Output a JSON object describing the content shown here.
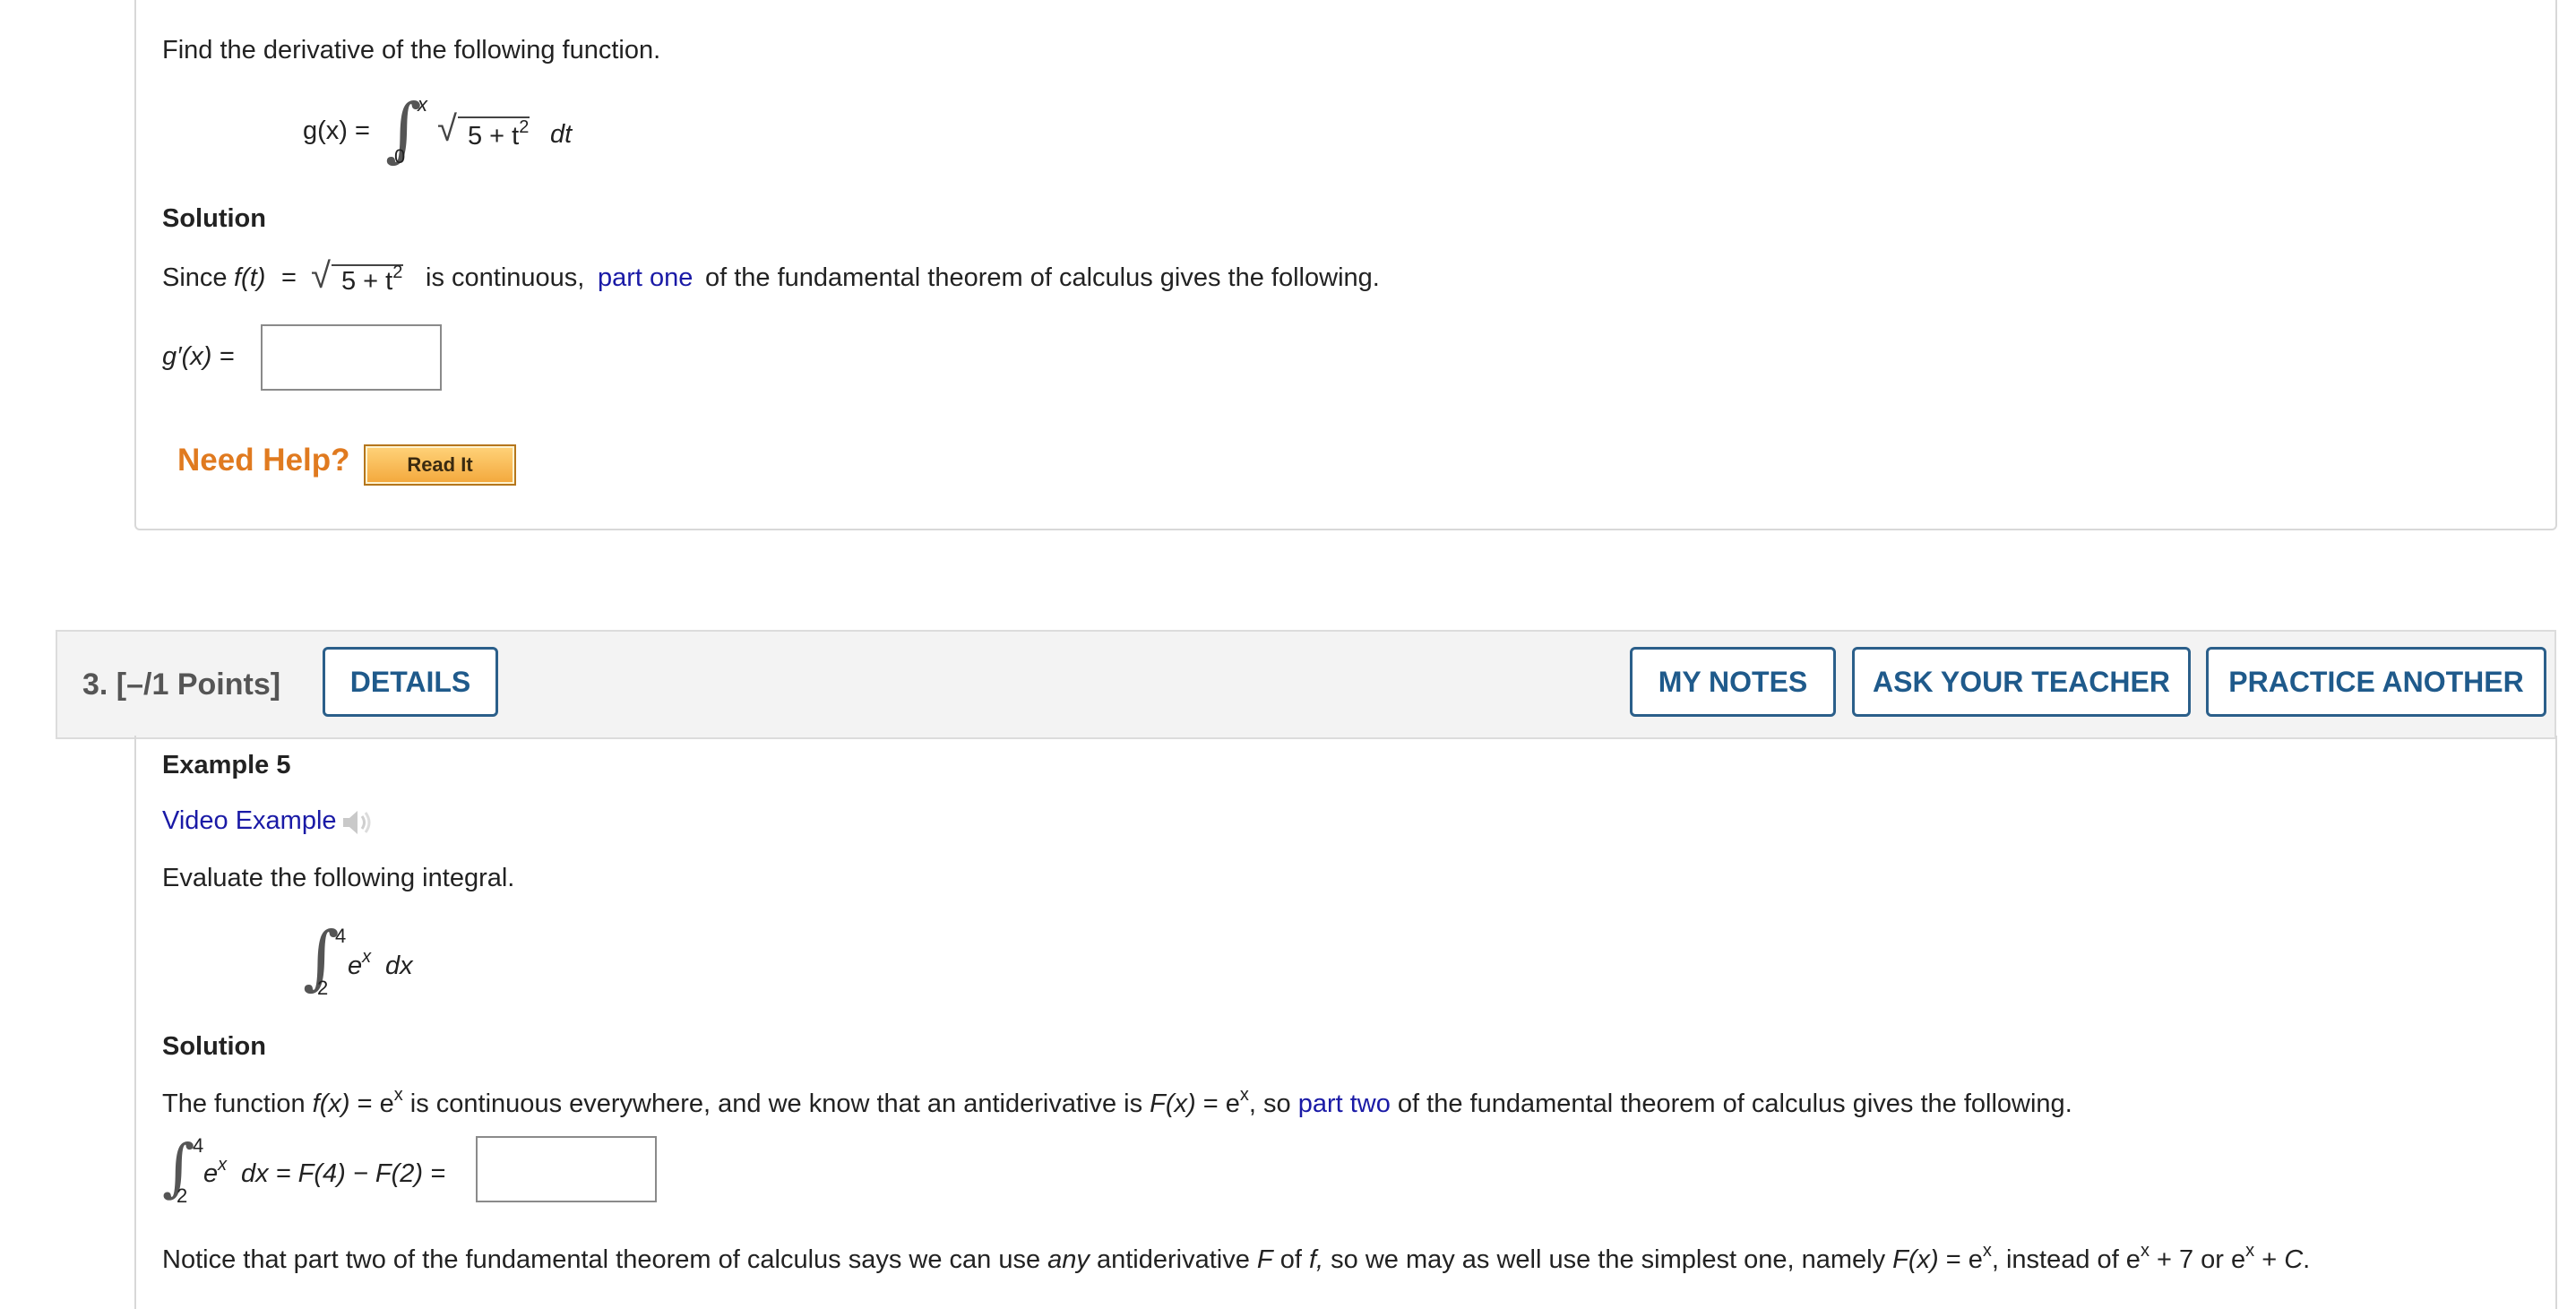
{
  "q2": {
    "instruction": "Find the derivative of the following function.",
    "function_lhs": "g(x) =",
    "upper_limit": "x",
    "lower_limit": "0",
    "radicand_a": "5 + t",
    "radicand_exp": "2",
    "dt": "dt",
    "solution_heading": "Solution",
    "since_a": "Since",
    "since_f": "f(t)",
    "since_eq": "=",
    "since_rad_a": "5 + t",
    "since_rad_exp": "2",
    "since_b": "is continuous,",
    "link_part_one": "part one",
    "since_c": "of the fundamental theorem of calculus gives the following.",
    "answer_label": "g′(x) =",
    "need_help": "Need Help?",
    "read_it": "Read It"
  },
  "q3": {
    "header_title": "3.  [–/1 Points]",
    "buttons": {
      "details": "DETAILS",
      "my_notes": "MY NOTES",
      "ask_teacher": "ASK YOUR TEACHER",
      "practice_another": "PRACTICE ANOTHER"
    },
    "example_heading": "Example 5",
    "video_example": "Video Example",
    "instruction": "Evaluate the following integral.",
    "upper_limit": "4",
    "lower_limit": "2",
    "integrand_base": "e",
    "integrand_exp": "x",
    "dx": "dx",
    "solution_heading": "Solution",
    "sentence_a": "The function",
    "sentence_f": "f(x)",
    "sentence_b": "= e",
    "sentence_b_exp": "x",
    "sentence_c": "is continuous everywhere, and we know that an antiderivative is",
    "sentence_F": "F(x)",
    "sentence_d": "= e",
    "sentence_d_exp": "x",
    "sentence_e": ", so",
    "link_part_two": "part two",
    "sentence_f2": "of the fundamental theorem of calculus gives the following.",
    "eval_upper": "4",
    "eval_lower": "2",
    "eval_base": "e",
    "eval_exp": "x",
    "eval_rest": "dx = F(4) − F(2) =",
    "notice_a": "Notice that part two of the fundamental theorem of calculus says we can use",
    "notice_any": "any",
    "notice_b": "antiderivative",
    "notice_F": "F",
    "notice_c": "of",
    "notice_f": "f,",
    "notice_d": "so we may as well use the simplest one, namely",
    "notice_Fx": "F(x)",
    "notice_e": "= e",
    "notice_e_exp": "x",
    "notice_f2": ", instead of e",
    "notice_f2_exp": "x",
    "notice_g": "+ 7 or e",
    "notice_g_exp": "x",
    "notice_h": "+",
    "notice_C": "C",
    "notice_end": "."
  }
}
